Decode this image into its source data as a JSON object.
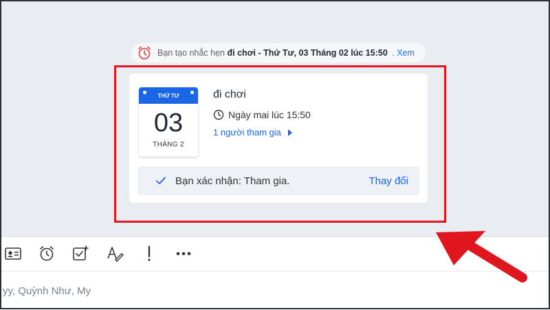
{
  "notice": {
    "prefix": "Bạn tạo nhắc hẹn",
    "event_name": "đi chơi - Thứ Tư, 03 Tháng 02 lúc 15:50",
    "view_link": ". Xem"
  },
  "event_card": {
    "calendar": {
      "weekday": "THỨ TƯ",
      "day": "03",
      "month": "THÁNG 2"
    },
    "title": "đi chơi",
    "time": "Ngày mai lúc 15:50",
    "attendees": "1 người tham gia",
    "confirm_text": "Bạn xác nhận: Tham gia.",
    "change_label": "Thay đổi"
  },
  "toolbar": {
    "items": [
      "contact-card-icon",
      "alarm-icon",
      "checklist-icon",
      "font-format-icon",
      "important-icon",
      "more-icon"
    ]
  },
  "input": {
    "text": "yy, Quỳnh Như, My"
  },
  "colors": {
    "accent": "#1a66e6",
    "highlight": "#e0161e",
    "background": "#e9ecf1"
  }
}
